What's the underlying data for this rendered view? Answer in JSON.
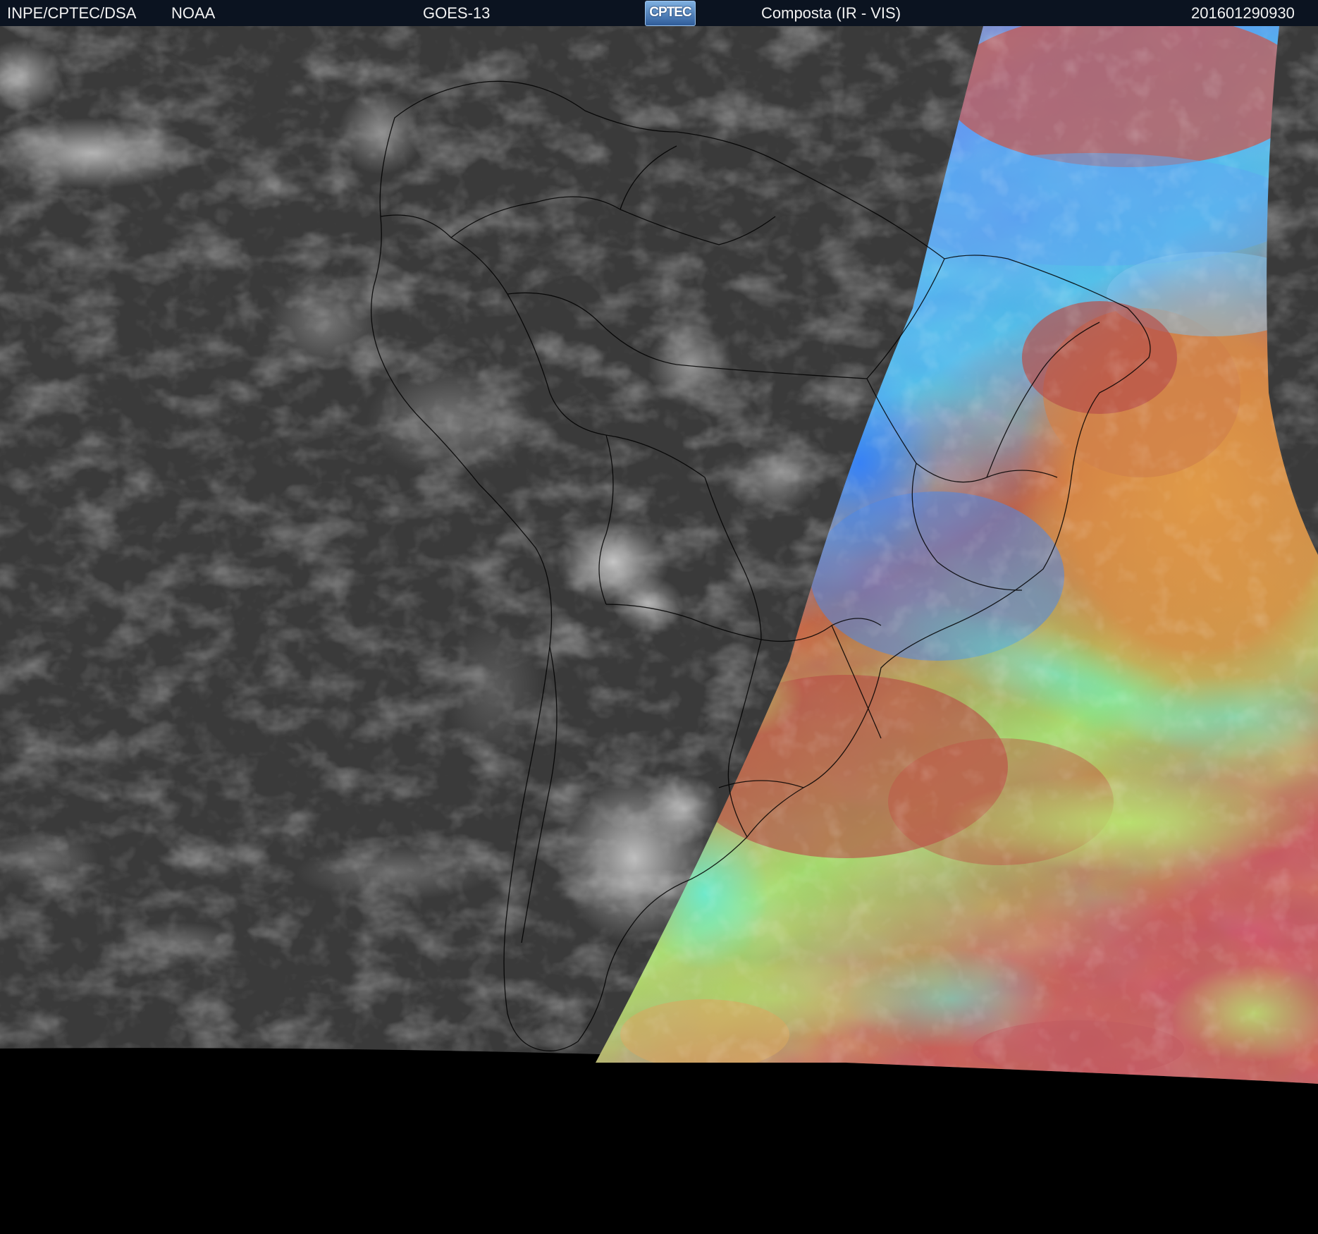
{
  "header": {
    "agency": "INPE/CPTEC/DSA",
    "provider": "NOAA",
    "satellite": "GOES-13",
    "logo": "CPTEC",
    "product": "Composta (IR - VIS)",
    "timestamp": "201601290930"
  },
  "colors": {
    "header_bg": "#0b1320",
    "night_ir": "#3a3a3a",
    "outer_space": "#000000",
    "day_orange": "#d08040",
    "day_red": "#b5524a",
    "day_blue": "#3f8ee8",
    "day_cyan": "#4fe0d8",
    "day_green": "#9ee06a",
    "borders": "#000000"
  }
}
